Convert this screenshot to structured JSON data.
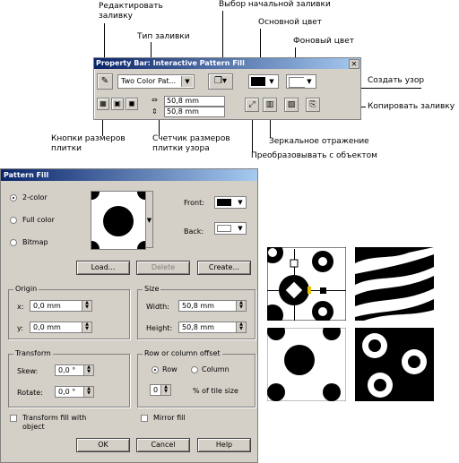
{
  "annotations": {
    "edit_fill": "Редактировать\nзаливку",
    "fill_type": "Тип заливки",
    "start_fill": "Выбор начальной заливки",
    "main_color": "Основной цвет",
    "bg_color": "Фоновый цвет",
    "create_pattern": "Создать узор",
    "copy_fill": "Копировать заливку",
    "tile_size_buttons": "Кнопки размеров\nплитки",
    "tile_counter": "Счетчик размеров\nплитки узора",
    "mirror": "Зеркальное отражение",
    "transform_with_object": "Преобразовывать с объектом"
  },
  "property_bar": {
    "title": "Property Bar: Interactive Pattern Fill",
    "fill_type_value": "Two Color Pat...",
    "width_value": "50,8 mm",
    "height_value": "50,8 mm"
  },
  "dialog": {
    "title": "Pattern Fill",
    "radio_2color": "2-color",
    "radio_fullcolor": "Full color",
    "radio_bitmap": "Bitmap",
    "front_label": "Front:",
    "back_label": "Back:",
    "load_label": "Load...",
    "delete_label": "Delete",
    "create_label": "Create...",
    "origin_title": "Origin",
    "x_label": "x:",
    "x_value": "0,0 mm",
    "y_label": "y:",
    "y_value": "0,0 mm",
    "size_title": "Size",
    "width_label": "Width:",
    "width_value": "50,8 mm",
    "height_label": "Height:",
    "height_value": "50,8 mm",
    "transform_title": "Transform",
    "skew_label": "Skew:",
    "skew_value": "0,0 °",
    "rotate_label": "Rotate:",
    "rotate_value": "0,0 °",
    "offset_title": "Row or column offset",
    "row_label": "Row",
    "column_label": "Column",
    "offset_value": "0",
    "offset_suffix": "% of tile size",
    "transform_fill_label": "Transform fill with\nobject",
    "mirror_fill_label": "Mirror fill",
    "ok_label": "OK",
    "cancel_label": "Cancel",
    "help_label": "Help"
  },
  "colors": {
    "title_bar": "#0a246a",
    "dialog_bg": "#d4d0c8",
    "front": "#000000",
    "back": "#ffffff"
  }
}
